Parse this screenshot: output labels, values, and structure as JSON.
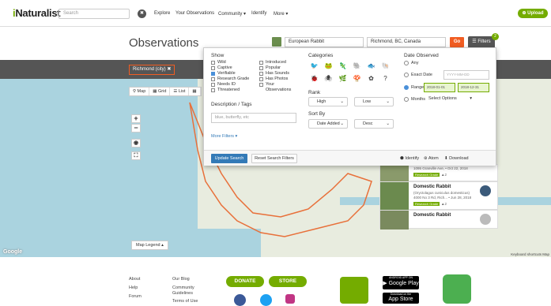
{
  "header": {
    "logo_prefix": "i",
    "logo_rest": "Naturalist",
    "search_placeholder": "Search",
    "nav": [
      "Explore",
      "Your Observations",
      "Community ▾",
      "Identify",
      "More ▾"
    ],
    "upload_label": "⊕ Upload"
  },
  "page": {
    "title": "Observations",
    "taxon_value": "European Rabbit",
    "place_value": "Richmond, BC, Canada",
    "go_label": "Go",
    "filters_label": "☰ Filters",
    "filters_count": "2",
    "place_chip": "Richmond (city) ✖"
  },
  "map": {
    "controls": [
      "⚲ Map",
      "▦ Grid",
      "☰ List",
      "▦"
    ],
    "legend_label": "Map Legend ▴",
    "google_label": "Google",
    "credit": "Keyboard shortcuts   Map"
  },
  "filters": {
    "show_title": "Show",
    "show_left": [
      {
        "label": "Wild",
        "checked": false
      },
      {
        "label": "Captive",
        "checked": false
      },
      {
        "label": "Verifiable",
        "checked": true
      },
      {
        "label": "Research Grade",
        "checked": false
      },
      {
        "label": "Needs ID",
        "checked": false
      },
      {
        "label": "Threatened",
        "checked": false
      }
    ],
    "show_right": [
      {
        "label": "Introduced",
        "checked": false
      },
      {
        "label": "Popular",
        "checked": false
      },
      {
        "label": "Has Sounds",
        "checked": false
      },
      {
        "label": "Has Photos",
        "checked": false
      },
      {
        "label": "Your",
        "checked": false
      }
    ],
    "show_right_extra": "Observations",
    "desc_title": "Description / Tags",
    "desc_placeholder": "blue, butterfly, etc",
    "more_filters": "More Filters ▾",
    "categories_title": "Categories",
    "rank_title": "Rank",
    "rank_high": "High",
    "rank_low": "Low",
    "sort_title": "Sort By",
    "sort_by": "Date Added",
    "sort_order": "Desc",
    "date_title": "Date Observed",
    "date_any": "Any",
    "date_exact": "Exact Date",
    "date_exact_placeholder": "YYYY-MM-DD",
    "date_range": "Range",
    "range_start": "2018-01-01",
    "range_end": "2018-12-31",
    "date_months": "Months",
    "months_select": "Select Options",
    "update_label": "Update Search",
    "reset_label": "Reset Search Filters",
    "identify_link": "⬢ Identify",
    "atom_link": "⊛ Atom",
    "download_link": "⬇ Download"
  },
  "observations": [
    {
      "name": "",
      "sub": "1095 Granville Ave, • Oct 22, 2018",
      "badge": "Research Grade",
      "extra": "▲2"
    },
    {
      "name": "Domestic Rabbit",
      "sub": "(Oryctolagus cuniculus domesticus)",
      "sub2": "4000 No 3 Rd, Rich... • Jun 28, 2018",
      "badge": "Research Grade",
      "extra": "▲2"
    },
    {
      "name": "Domestic Rabbit",
      "sub": "",
      "badge": "",
      "extra": ""
    }
  ],
  "footer": {
    "col1": [
      "About",
      "Help",
      "Forum"
    ],
    "col2": [
      "Our Blog",
      "Community",
      "Guidelines",
      "Terms of Use"
    ],
    "donate": "DONATE",
    "store": "STORE",
    "google_play": "▶ Google Play",
    "app_store": " App Store",
    "google_play_small": "ANDROID APP ON",
    "app_store_small": "Download on the"
  }
}
